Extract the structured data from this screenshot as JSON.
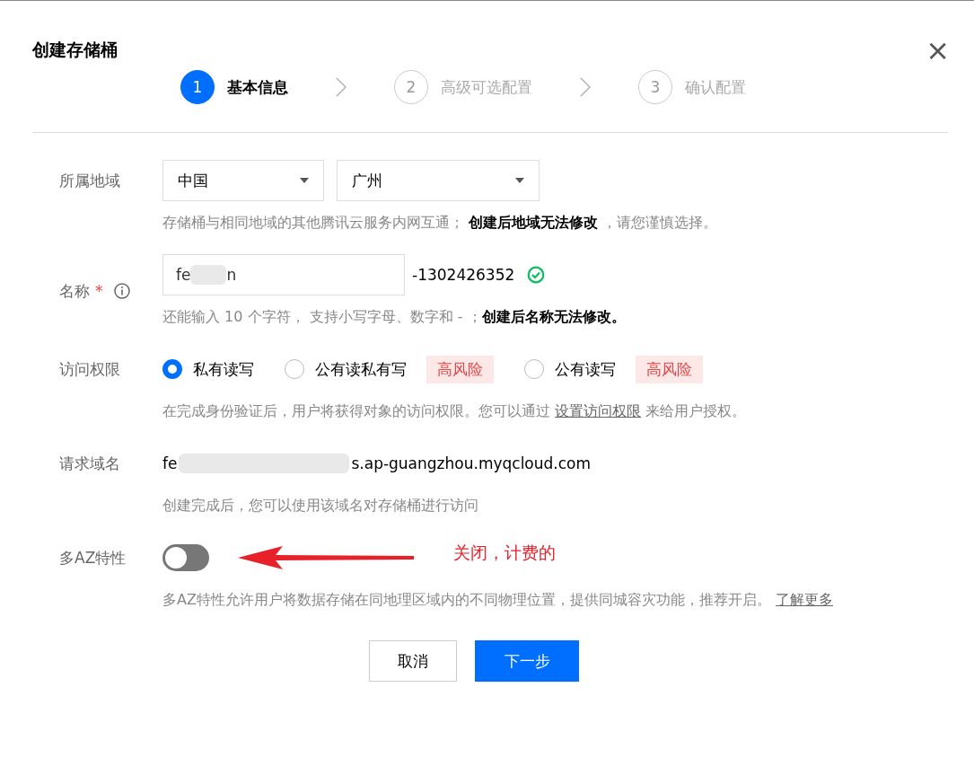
{
  "dialog": {
    "title": "创建存储桶",
    "close": "×"
  },
  "steps": [
    {
      "number": "1",
      "label": "基本信息",
      "selected": true
    },
    {
      "number": "2",
      "label": "高级可选配置",
      "selected": false
    },
    {
      "number": "3",
      "label": "确认配置",
      "selected": false
    }
  ],
  "region": {
    "label": "所属地域",
    "selects": [
      "中国",
      "广州"
    ],
    "hint_before": "存储桶与相同地域的其他腾讯云服务内网互通；",
    "hint_bold": "创建后地域无法修改",
    "hint_after": "，请您谨慎选择。"
  },
  "name": {
    "label": "名称",
    "required": "*",
    "value_start": "fe",
    "value_end": "n",
    "suffix": "-1302426352",
    "valid": true,
    "hint_before": "还能输入 10 个字符， 支持小写字母、数字和 - ；",
    "hint_bold": "创建后名称无法修改。"
  },
  "access": {
    "label": "访问权限",
    "options": [
      {
        "label": "私有读写",
        "selected": true
      },
      {
        "label": "公有读私有写",
        "selected": false,
        "tag": "高风险"
      },
      {
        "label": "公有读写",
        "selected": false,
        "tag": "高风险"
      }
    ],
    "hint_before": "在完成身份验证后，用户将获得对象的访问权限。您可以通过",
    "hint_link": "设置访问权限",
    "hint_after": "来给用户授权。"
  },
  "domain": {
    "label": "请求域名",
    "value_start": "fe",
    "value_end": "s.ap-guangzhou.myqcloud.com",
    "hint": "创建完成后，您可以使用该域名对存储桶进行访问"
  },
  "multi_az": {
    "label": "多AZ特性",
    "on": false,
    "annotation": "关闭，计费的",
    "hint": "多AZ特性允许用户将数据存储在同地理区域内的不同物理位置，提供同城容灾功能，推荐开启。",
    "hint_link": "了解更多"
  },
  "buttons": [
    {
      "label": "取消",
      "kind": "secondary"
    },
    {
      "label": "下一步",
      "kind": "primary"
    }
  ]
}
